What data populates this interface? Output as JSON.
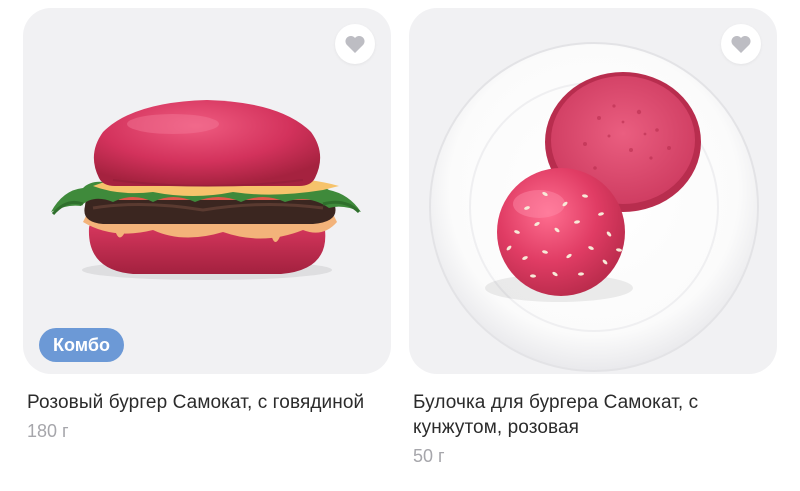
{
  "colors": {
    "tile_bg": "#f1f1f3",
    "badge_bg": "#6c99d6",
    "title_text": "#2b2b2b",
    "weight_text": "#a6a6ab",
    "heart": "#bdbdc3",
    "bun_pink": "#d93a64"
  },
  "products": [
    {
      "title": "Розовый бургер Самокат, с говядиной",
      "weight": "180 г",
      "badge": "Комбо",
      "favorite_icon": "heart-icon"
    },
    {
      "title": "Булочка для бургера Самокат, с кунжутом, розовая",
      "weight": "50 г",
      "favorite_icon": "heart-icon"
    }
  ]
}
